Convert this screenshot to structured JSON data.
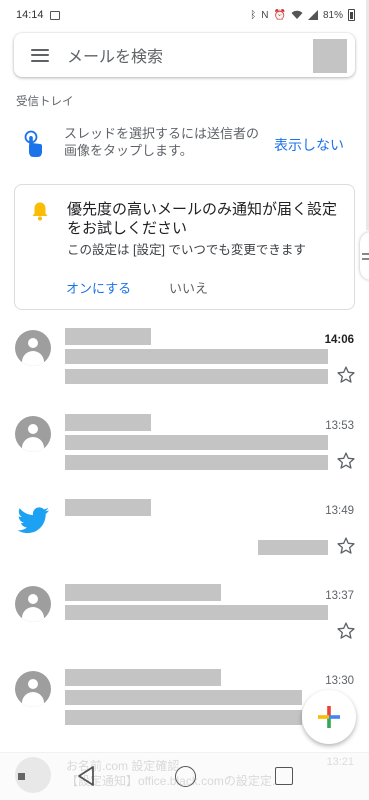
{
  "status_bar": {
    "time": "14:14",
    "battery": "81%"
  },
  "search": {
    "placeholder": "メールを検索"
  },
  "section_label": "受信トレイ",
  "tip": {
    "text": "スレッドを選択するには送信者の画像をタップします。",
    "dismiss_label": "表示しない"
  },
  "promo": {
    "title": "優先度の高いメールのみ通知が届く設定をお試しください",
    "subtitle": "この設定は [設定] でいつでも変更できます",
    "turn_on_label": "オンにする",
    "no_label": "いいえ"
  },
  "emails": [
    {
      "time": "14:06",
      "unread": true,
      "avatar": "person-icon"
    },
    {
      "time": "13:53",
      "unread": false,
      "avatar": "person-icon"
    },
    {
      "time": "13:49",
      "unread": false,
      "avatar": "twitter-icon"
    },
    {
      "time": "13:37",
      "unread": false,
      "avatar": "person-icon"
    },
    {
      "time": "13:30",
      "unread": false,
      "avatar": "person-icon"
    }
  ],
  "partial_email": {
    "sender": "お名前.com 設定確認",
    "preview": "【設定通知】office.black.comの設定定...",
    "time": "13:21"
  },
  "colors": {
    "accent": "#1a73e8",
    "twitter": "#1da1f2",
    "redaction": "#c4c4c4"
  }
}
